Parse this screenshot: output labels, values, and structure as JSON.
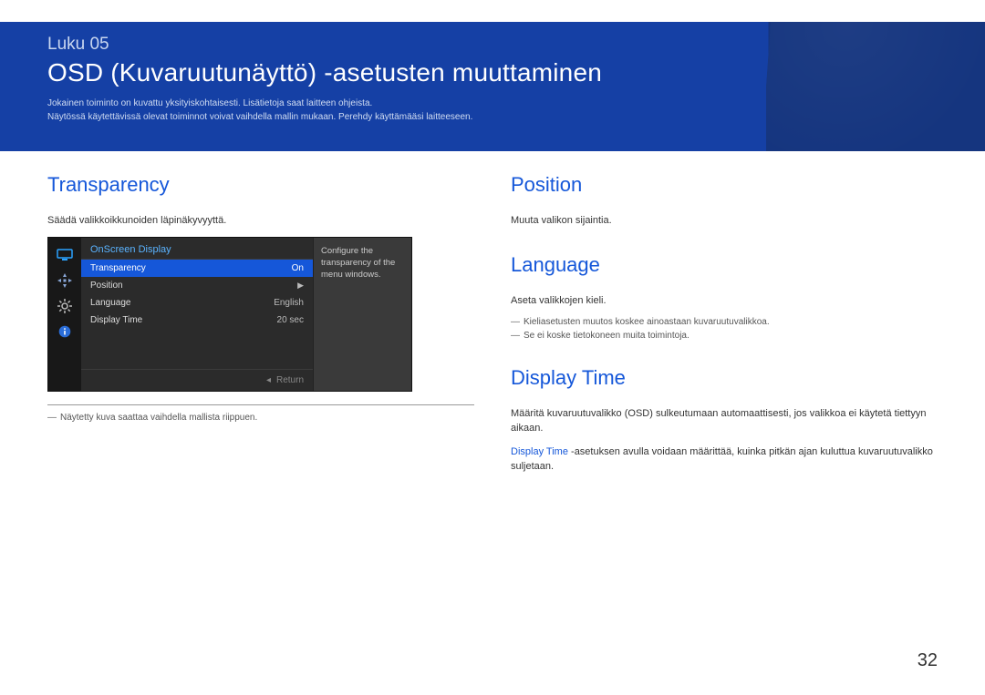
{
  "banner": {
    "chapter": "Luku 05",
    "title": "OSD (Kuvaruutunäyttö) -asetusten muuttaminen",
    "intro1": "Jokainen toiminto on kuvattu yksityiskohtaisesti. Lisätietoja saat laitteen ohjeista.",
    "intro2": "Näytössä käytettävissä olevat toiminnot voivat vaihdella mallin mukaan. Perehdy käyttämääsi laitteeseen."
  },
  "left": {
    "heading": "Transparency",
    "desc": "Säädä valikkoikkunoiden läpinäkyvyyttä.",
    "footnote": "Näytetty kuva saattaa vaihdella mallista riippuen."
  },
  "osd": {
    "title": "OnScreen Display",
    "help": "Configure the transparency of the menu windows.",
    "return_label": "Return",
    "rows": [
      {
        "label": "Transparency",
        "value": "On",
        "selected": true
      },
      {
        "label": "Position",
        "value": "",
        "arrow": true
      },
      {
        "label": "Language",
        "value": "English"
      },
      {
        "label": "Display Time",
        "value": "20 sec"
      }
    ]
  },
  "right": {
    "position": {
      "heading": "Position",
      "desc": "Muuta valikon sijaintia."
    },
    "language": {
      "heading": "Language",
      "desc": "Aseta valikkojen kieli.",
      "note1": "Kieliasetusten muutos koskee ainoastaan kuvaruutuvalikkoa.",
      "note2": "Se ei koske tietokoneen muita toimintoja."
    },
    "display_time": {
      "heading": "Display Time",
      "line1": "Määritä kuvaruutuvalikko (OSD) sulkeutumaan automaattisesti, jos valikkoa ei käytetä tiettyyn aikaan.",
      "em": "Display Time",
      "line2_tail": " -asetuksen avulla voidaan määrittää, kuinka pitkän ajan kuluttua kuvaruutuvalikko suljetaan."
    }
  },
  "page_number": "32"
}
